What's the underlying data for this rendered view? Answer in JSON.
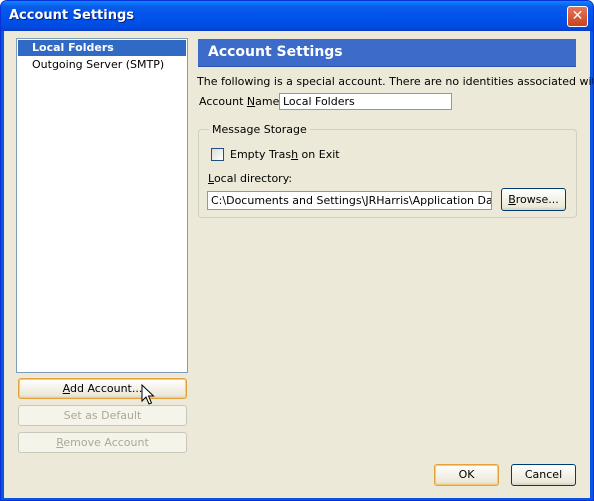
{
  "window": {
    "title": "Account Settings",
    "close_glyph": "✕",
    "close_icon": "close-icon"
  },
  "accounts": {
    "items": [
      {
        "label": "Local Folders",
        "selected": true
      },
      {
        "label": "Outgoing Server (SMTP)",
        "selected": false
      }
    ],
    "add_button": {
      "before": "",
      "key": "A",
      "after": "dd Account..."
    },
    "default_button": "Set as Default",
    "remove_button": {
      "before": "",
      "key": "R",
      "after": "emove Account"
    }
  },
  "panel": {
    "header": "Account Settings",
    "info": "The following is a special account. There are no identities associated with it.",
    "account_name": {
      "before": "Account ",
      "key": "N",
      "after": "ame:",
      "value": "Local Folders"
    },
    "storage": {
      "legend": "Message Storage",
      "empty_trash": {
        "before": "Empty Tras",
        "key": "h",
        "after": " on Exit",
        "checked": false
      },
      "local_directory": {
        "before": "",
        "key": "L",
        "after": "ocal directory:"
      },
      "path": "C:\\Documents and Settings\\JRHarris\\Application Data\\Thun",
      "browse": {
        "before": "",
        "key": "B",
        "after": "rowse..."
      }
    }
  },
  "footer": {
    "ok": "OK",
    "cancel": "Cancel"
  },
  "colors": {
    "titlebar": "#0054e3",
    "header_bar": "#3c6bc9",
    "selection": "#316ac5",
    "dialog_bg": "#ece9d8"
  }
}
